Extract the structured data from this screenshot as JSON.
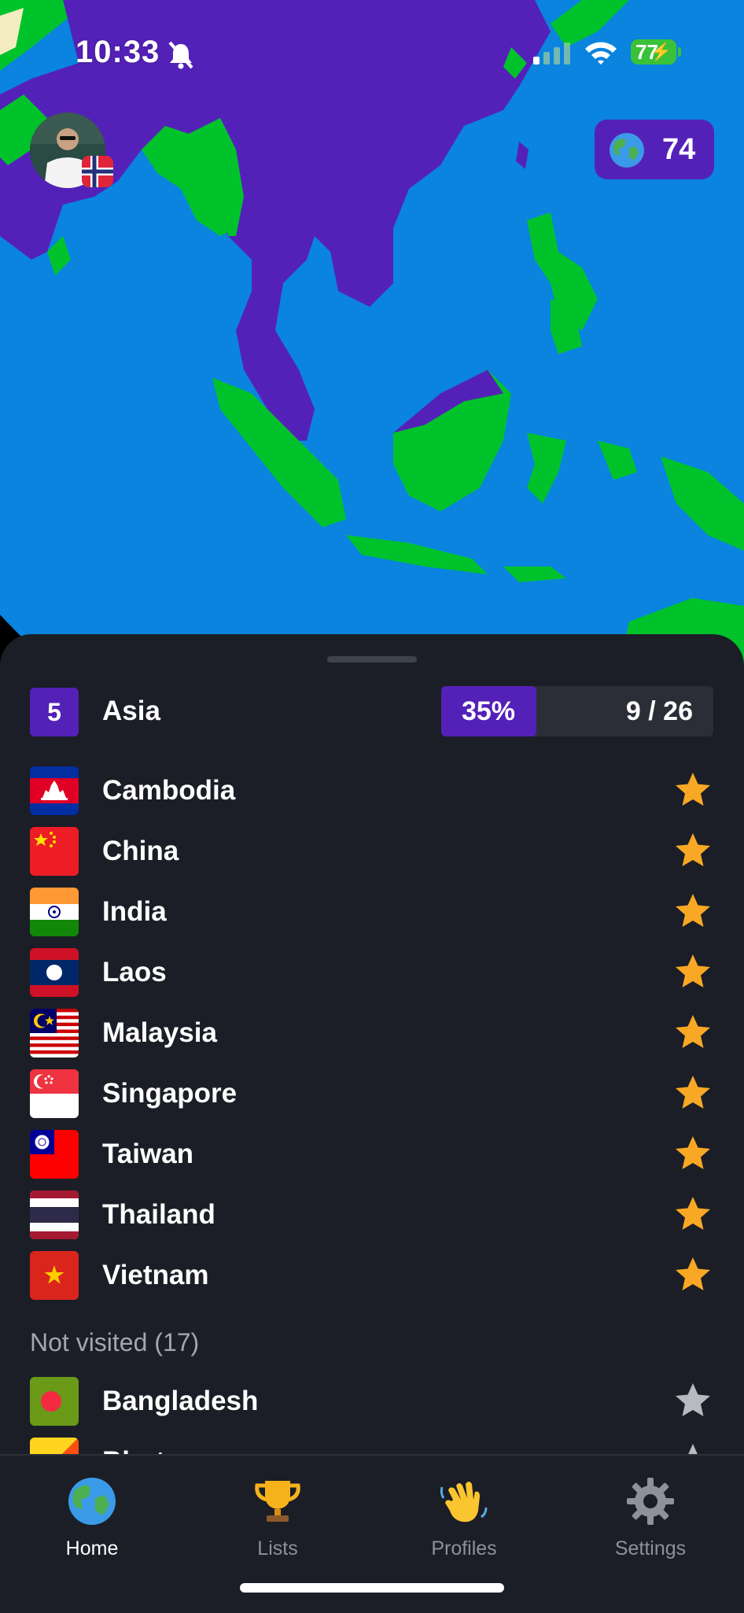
{
  "status_bar": {
    "time": "10:33",
    "battery": "77"
  },
  "header": {
    "score": "74"
  },
  "continent": {
    "badge": "5",
    "name": "Asia",
    "percent_label": "35%",
    "progress_fraction": 0.35,
    "count_label": "9 / 26"
  },
  "visited": [
    {
      "name": "Cambodia",
      "flag": "cambodia-flag"
    },
    {
      "name": "China",
      "flag": "china-flag"
    },
    {
      "name": "India",
      "flag": "india-flag"
    },
    {
      "name": "Laos",
      "flag": "laos-flag"
    },
    {
      "name": "Malaysia",
      "flag": "malaysia-flag"
    },
    {
      "name": "Singapore",
      "flag": "singapore-flag"
    },
    {
      "name": "Taiwan",
      "flag": "taiwan-flag"
    },
    {
      "name": "Thailand",
      "flag": "thailand-flag"
    },
    {
      "name": "Vietnam",
      "flag": "vietnam-flag"
    }
  ],
  "not_visited_label": "Not visited (17)",
  "not_visited": [
    {
      "name": "Bangladesh",
      "flag": "bangladesh-flag"
    },
    {
      "name": "Bhutan",
      "flag": "bhutan-flag"
    }
  ],
  "tabs": [
    {
      "label": "Home",
      "icon": "globe-icon",
      "active": true
    },
    {
      "label": "Lists",
      "icon": "trophy-icon",
      "active": false
    },
    {
      "label": "Profiles",
      "icon": "waving-hand-icon",
      "active": false
    },
    {
      "label": "Settings",
      "icon": "gear-icon",
      "active": false
    }
  ],
  "colors": {
    "visited": "#5421b8",
    "not_visited_land": "#00c32c",
    "ocean": "#0a84de",
    "star_visited": "#f9a825",
    "star_unvisited": "#b8babf",
    "sheet_bg": "#1b1e26"
  }
}
